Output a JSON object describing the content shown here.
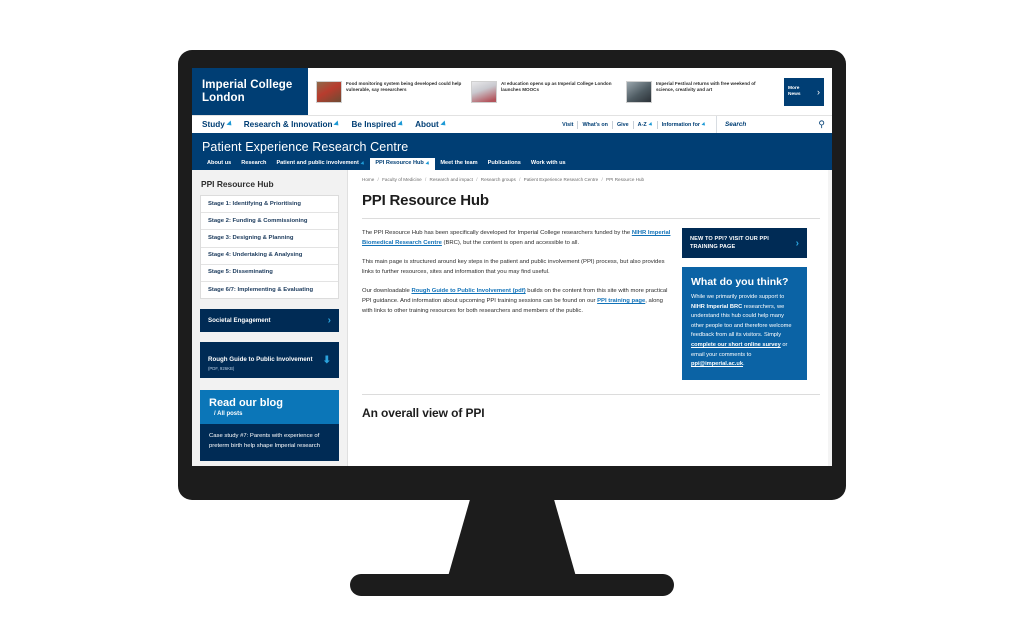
{
  "site": {
    "logo_line1": "Imperial College",
    "logo_line2": "London",
    "news": [
      {
        "text": "Food monitoring system being developed could help vulnerable, say researchers",
        "thumb": "food-thumb"
      },
      {
        "text": "AI education opens up as Imperial College London launches MOOCs",
        "thumb": "ai-thumb"
      },
      {
        "text": "Imperial Festival returns with free weekend of science, creativity and art",
        "thumb": "festival-thumb"
      }
    ],
    "more_news_line1": "More",
    "more_news_line2": "News"
  },
  "main_nav": [
    {
      "label": "Study"
    },
    {
      "label": "Research & Innovation"
    },
    {
      "label": "Be Inspired"
    },
    {
      "label": "About"
    }
  ],
  "utility_nav": [
    {
      "label": "Visit",
      "caret": false
    },
    {
      "label": "What's on",
      "caret": false
    },
    {
      "label": "Give",
      "caret": false
    },
    {
      "label": "A-Z",
      "caret": true
    },
    {
      "label": "Information for",
      "caret": true
    }
  ],
  "search": {
    "placeholder": "Search",
    "icon": "magnifier-icon"
  },
  "department": {
    "title": "Patient Experience Research Centre",
    "nav": [
      {
        "label": "About us",
        "caret": false,
        "active": false
      },
      {
        "label": "Research",
        "caret": false,
        "active": false
      },
      {
        "label": "Patient and public involvement",
        "caret": true,
        "active": false
      },
      {
        "label": "PPI Resource Hub",
        "caret": true,
        "active": true
      },
      {
        "label": "Meet the team",
        "caret": false,
        "active": false
      },
      {
        "label": "Publications",
        "caret": false,
        "active": false
      },
      {
        "label": "Work with us",
        "caret": false,
        "active": false
      }
    ]
  },
  "breadcrumb": [
    "Home",
    "Faculty of Medicine",
    "Research and impact",
    "Research groups",
    "Patient Experience Research Centre",
    "PPI Resource Hub"
  ],
  "sidebar": {
    "title": "PPI Resource Hub",
    "stages": [
      "Stage 1: Identifying & Prioritising",
      "Stage 2: Funding & Commissioning",
      "Stage 3: Designing & Planning",
      "Stage 4: Undertaking & Analysing",
      "Stage 5: Disseminating",
      "Stage 6/7: Implementing & Evaluating"
    ],
    "societal": {
      "label": "Societal Engagement",
      "icon": "chevron-right-icon"
    },
    "rough_guide": {
      "label": "Rough Guide to Public Involvement",
      "sub": "(PDF, 926KB)",
      "icon": "download-arrow-icon"
    },
    "blog": {
      "title": "Read our blog",
      "all_posts": "/ All posts",
      "excerpt": "Case study #7: Parents with experience of preterm birth help shape Imperial research"
    }
  },
  "main": {
    "h1": "PPI Resource Hub",
    "paragraphs": [
      {
        "parts": [
          {
            "t": "The PPI Resource Hub has been specifically developed for Imperial College researchers funded by the ",
            "link": false
          },
          {
            "t": "NIHR Imperial Biomedical Research Centre",
            "link": true
          },
          {
            "t": " (BRC), but the content is open and accessible to all.",
            "link": false
          }
        ]
      },
      {
        "parts": [
          {
            "t": "This main page is structured around key steps in the patient and public involvement (PPI) process, but also provides links to further resources, sites and information that you may find useful.",
            "link": false
          }
        ]
      },
      {
        "parts": [
          {
            "t": "Our downloadable ",
            "link": false
          },
          {
            "t": "Rough Guide to Public Involvement (pdf)",
            "link": true
          },
          {
            "t": " builds on the content from this site with more practical PPI guidance. And information about upcoming PPI training sessions can be found on our ",
            "link": false
          },
          {
            "t": "PPI training page",
            "link": true
          },
          {
            "t": ", along with links to other training resources for both researchers and members of the public.",
            "link": false
          }
        ]
      }
    ],
    "cta": {
      "label": "NEW TO PPI? VISIT OUR PPI TRAINING PAGE",
      "icon": "chevron-right-icon"
    },
    "feedback": {
      "heading": "What do you think?",
      "parts": [
        {
          "t": "While we primarily provide support to ",
          "link": false,
          "bold": false
        },
        {
          "t": "NIHR Imperial BRC",
          "link": false,
          "bold": true
        },
        {
          "t": " researchers, we understand this hub could help many other people too and therefore welcome feedback from all its visitors. Simply ",
          "link": false,
          "bold": false
        },
        {
          "t": "complete our short online survey",
          "link": true,
          "bold": true
        },
        {
          "t": " or email your comments to ",
          "link": false,
          "bold": false
        },
        {
          "t": "ppi@imperial.ac.uk",
          "link": true,
          "bold": true
        },
        {
          "t": ".",
          "link": false,
          "bold": false
        }
      ]
    },
    "section_h2": "An overall view of PPI"
  },
  "colors": {
    "imperial_navy": "#003e74",
    "dark_navy": "#002b55",
    "accent_blue": "#0b63a5",
    "blog_blue": "#0b76b8",
    "link_blue": "#1172b8",
    "caret_cyan": "#1e9ad6",
    "monitor_body": "#1c1c1c"
  }
}
